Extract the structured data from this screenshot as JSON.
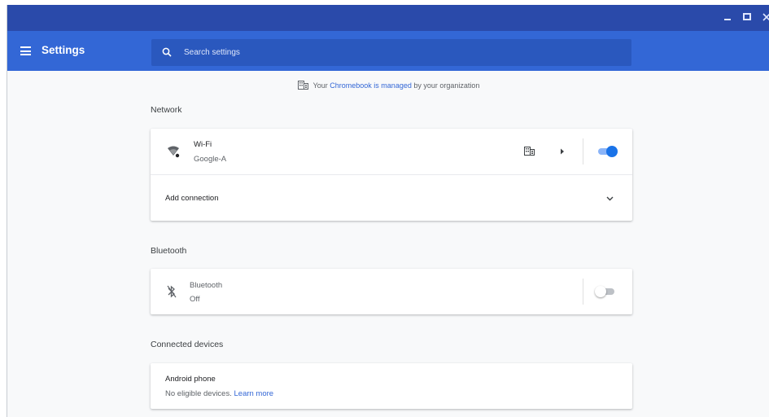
{
  "window": {
    "controls": {
      "minimize": "minimize-icon",
      "maximize": "maximize-icon",
      "close": "close-icon"
    }
  },
  "header": {
    "title": "Settings",
    "menu_icon": "hamburger-menu-icon",
    "search": {
      "placeholder": "Search settings",
      "value": "",
      "icon": "search-icon"
    }
  },
  "banner": {
    "icon": "building-icon",
    "prefix": "Your ",
    "link": "Chromebook is managed",
    "suffix": " by your organization"
  },
  "network": {
    "title": "Network",
    "wifi": {
      "label": "Wi-Fi",
      "network": "Google-A",
      "icon": "wifi-icon",
      "managed_icon": "building-icon",
      "arrow_icon": "arrow-right-icon",
      "enabled": true
    },
    "add_connection": {
      "label": "Add connection",
      "icon": "chevron-down-icon"
    }
  },
  "bluetooth": {
    "title": "Bluetooth",
    "label": "Bluetooth",
    "status": "Off",
    "icon": "bluetooth-icon",
    "enabled": false
  },
  "connected_devices": {
    "title": "Connected devices",
    "android": {
      "label": "Android phone",
      "status": "No eligible devices.",
      "link": "Learn more"
    }
  },
  "colors": {
    "titlebar": "#2a4aaa",
    "header": "#3367d6",
    "search": "#2a58be",
    "accent": "#1a73e8",
    "link": "#3367d6"
  }
}
